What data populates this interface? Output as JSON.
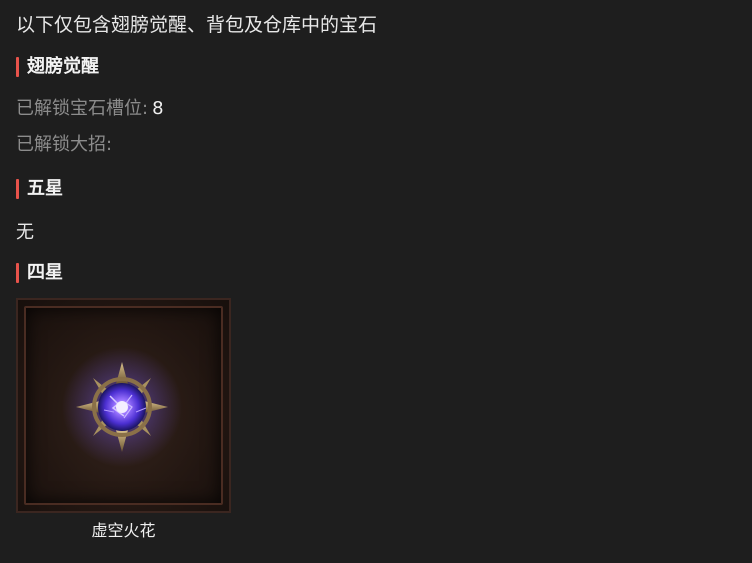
{
  "intro": "以下仅包含翅膀觉醒、背包及仓库中的宝石",
  "sections": {
    "wings": {
      "heading": "翅膀觉醒",
      "slots_label": "已解锁宝石槽位:",
      "slots_value": "8",
      "ult_label": "已解锁大招:",
      "ult_value": ""
    },
    "five_star": {
      "heading": "五星",
      "empty_text": "无"
    },
    "four_star": {
      "heading": "四星",
      "gems": [
        {
          "name": "虚空火花",
          "icon": "void-spark-gem-icon"
        }
      ]
    }
  },
  "colors": {
    "background": "#1e1e1e",
    "accent_bar": "#e8534b",
    "muted_label": "#8c8c8c",
    "gem_glow": "#7a5cff"
  }
}
